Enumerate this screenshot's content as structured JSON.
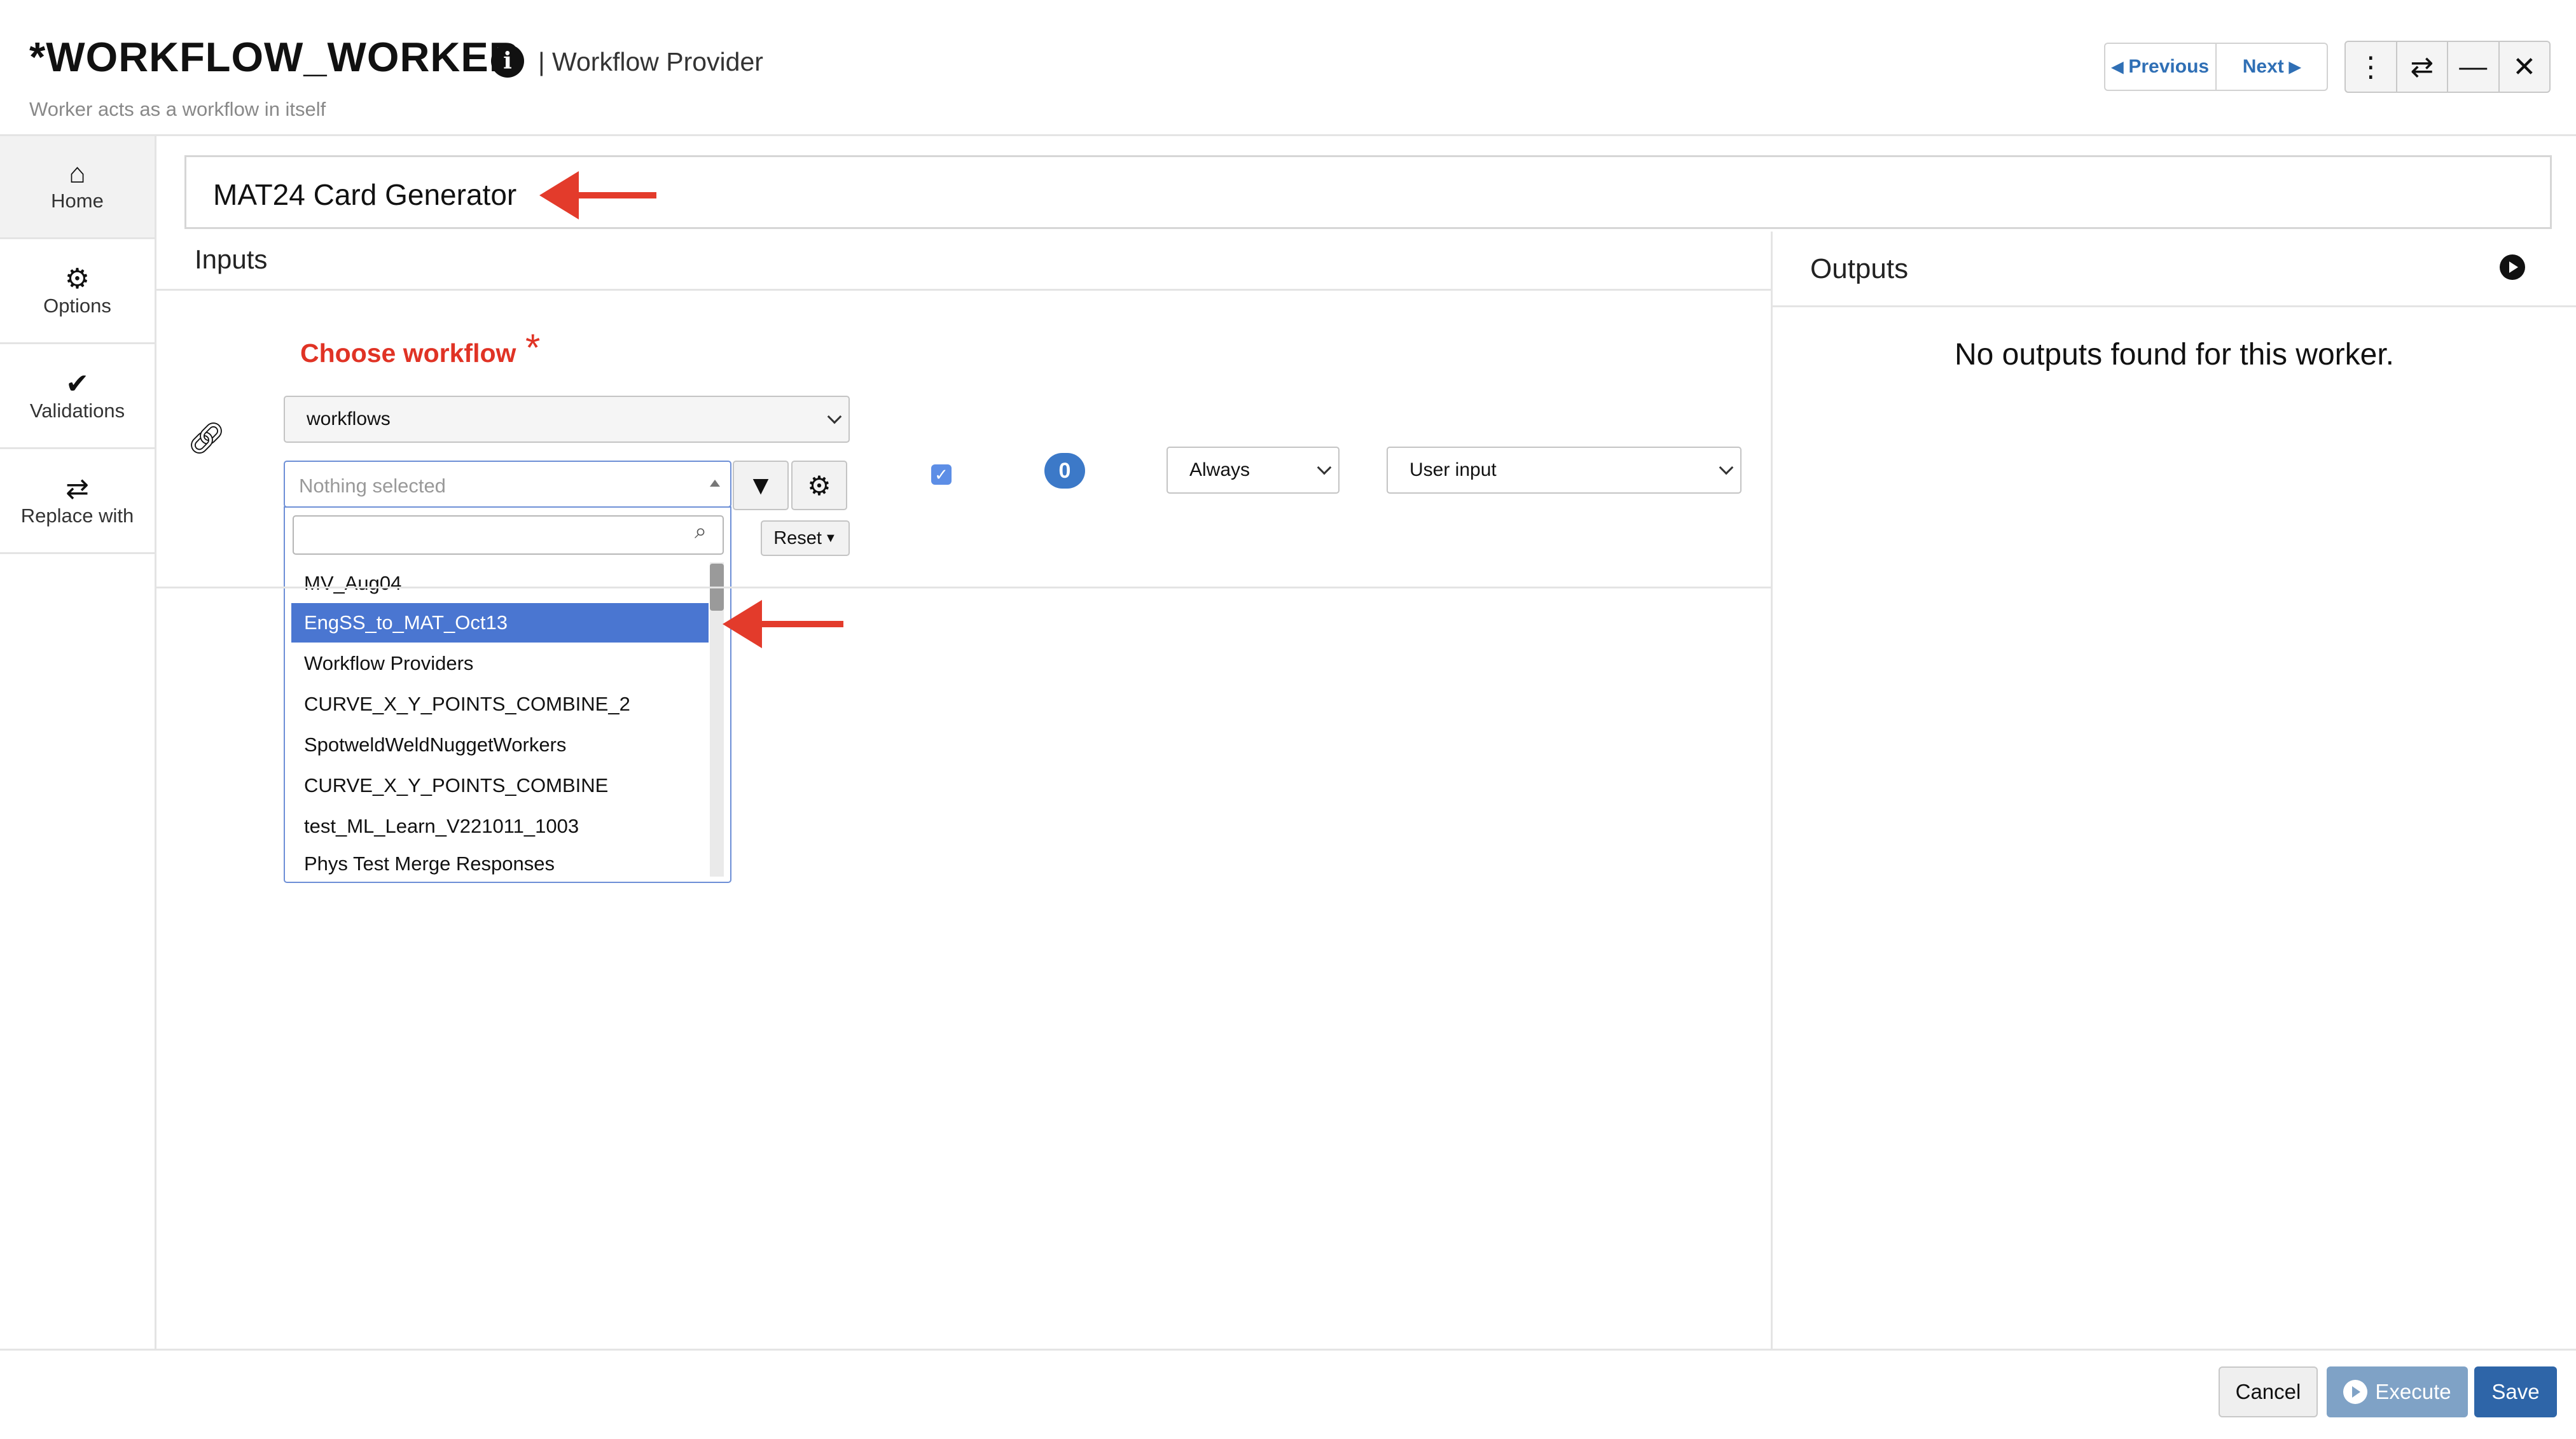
{
  "header": {
    "title": "*WORKFLOW_WORKER",
    "subtitle": "| Workflow Provider",
    "description": "Worker acts as a workflow in itself",
    "previous_label": "Previous",
    "next_label": "Next",
    "icons": [
      "info-icon",
      "more-vertical-icon",
      "swap-icon",
      "minimize-icon",
      "close-icon"
    ]
  },
  "sidebar": {
    "items": [
      {
        "label": "Home",
        "icon": "home-icon"
      },
      {
        "label": "Options",
        "icon": "gear-icon"
      },
      {
        "label": "Validations",
        "icon": "check-icon"
      },
      {
        "label": "Replace with",
        "icon": "swap-icon"
      }
    ]
  },
  "worker_name": "MAT24 Card Generator",
  "inputs": {
    "heading": "Inputs",
    "field_label": "Choose workflow",
    "required_marker": "*",
    "source_select": "workflows",
    "multiselect_placeholder": "Nothing selected",
    "reset_label": "Reset",
    "search_value": "",
    "options": [
      "MV_Aug04",
      "EngSS_to_MAT_Oct13",
      "Workflow Providers",
      "CURVE_X_Y_POINTS_COMBINE_2",
      "SpotweldWeldNuggetWorkers",
      "CURVE_X_Y_POINTS_COMBINE",
      "test_ML_Learn_V221011_1003",
      "Phys Test Merge Responses"
    ],
    "highlighted_option": "EngSS_to_MAT_Oct13",
    "checkbox_checked": true,
    "count_badge": "0",
    "condition_select": "Always",
    "source_type_select": "User input"
  },
  "outputs": {
    "heading": "Outputs",
    "empty_message": "No outputs found for this worker."
  },
  "footer": {
    "cancel_label": "Cancel",
    "execute_label": "Execute",
    "save_label": "Save"
  },
  "colors": {
    "required_red": "#e03325",
    "selected_blue": "#4a76d1",
    "save_blue": "#2e65a8",
    "annotation_arrow": "#e33b2b"
  }
}
